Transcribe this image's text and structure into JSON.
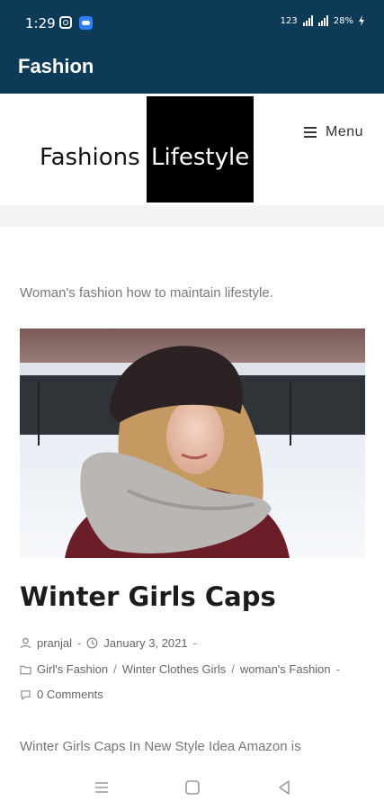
{
  "status_bar": {
    "time": "1:29",
    "net1": "123",
    "battery": "28%",
    "icons": [
      "instagram-icon",
      "cloud-app-icon",
      "signal-icon",
      "battery-icon"
    ]
  },
  "app_bar": {
    "title": "Fashion"
  },
  "site": {
    "logo_left": "Fashions",
    "logo_right": "Lifestyle",
    "menu_label": "Menu",
    "tagline": "Woman's fashion how to maintain lifestyle."
  },
  "post": {
    "title": "Winter Girls Caps",
    "author": "pranjal",
    "date": "January 3, 2021",
    "categories": [
      "Girl's Fashion",
      "Winter Clothes Girls",
      "woman's Fashion"
    ],
    "comments": "0 Comments",
    "excerpt": "Winter Girls Caps In New Style Idea Amazon is"
  },
  "colors": {
    "header_bg": "#0d3b57",
    "logo_box": "#000000"
  }
}
